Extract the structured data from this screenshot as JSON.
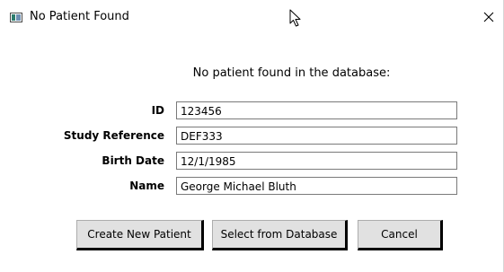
{
  "window": {
    "title": "No Patient Found",
    "close_glyph": "✕"
  },
  "message": "No patient found in the database:",
  "form": {
    "id": {
      "label": "ID",
      "value": "123456"
    },
    "study_reference": {
      "label": "Study Reference",
      "value": "DEF333"
    },
    "birth_date": {
      "label": "Birth Date",
      "value": "12/1/1985"
    },
    "name": {
      "label": "Name",
      "value": "George Michael Bluth"
    }
  },
  "buttons": {
    "create_new_patient": "Create New Patient",
    "select_from_database": "Select from Database",
    "cancel": "Cancel"
  },
  "icons": {
    "app": "app-window-icon",
    "close": "close-icon",
    "cursor": "mouse-pointer-icon"
  }
}
